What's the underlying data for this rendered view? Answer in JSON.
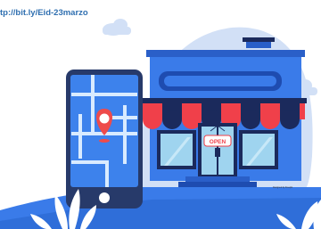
{
  "url_text": "tp://bit.ly/Eid-23marzo",
  "shop": {
    "sign": "OPEN"
  },
  "credit": "Designed by Freepik",
  "colors": {
    "blob": "#d2e0f6",
    "wall": "#3a7be9",
    "wall_dark": "#2a5fc8",
    "awning_red": "#f0404a",
    "awning_navy": "#1b2a5c",
    "glass": "#9fd4ef",
    "phone_frame": "#273a6a",
    "map_bg": "#3d82ec",
    "pin": "#ee4b4b",
    "ground": "#3a7be9",
    "plant": "#ffffff"
  },
  "icons": [
    "location-pin-icon",
    "cloud-icon",
    "plant-icon"
  ]
}
